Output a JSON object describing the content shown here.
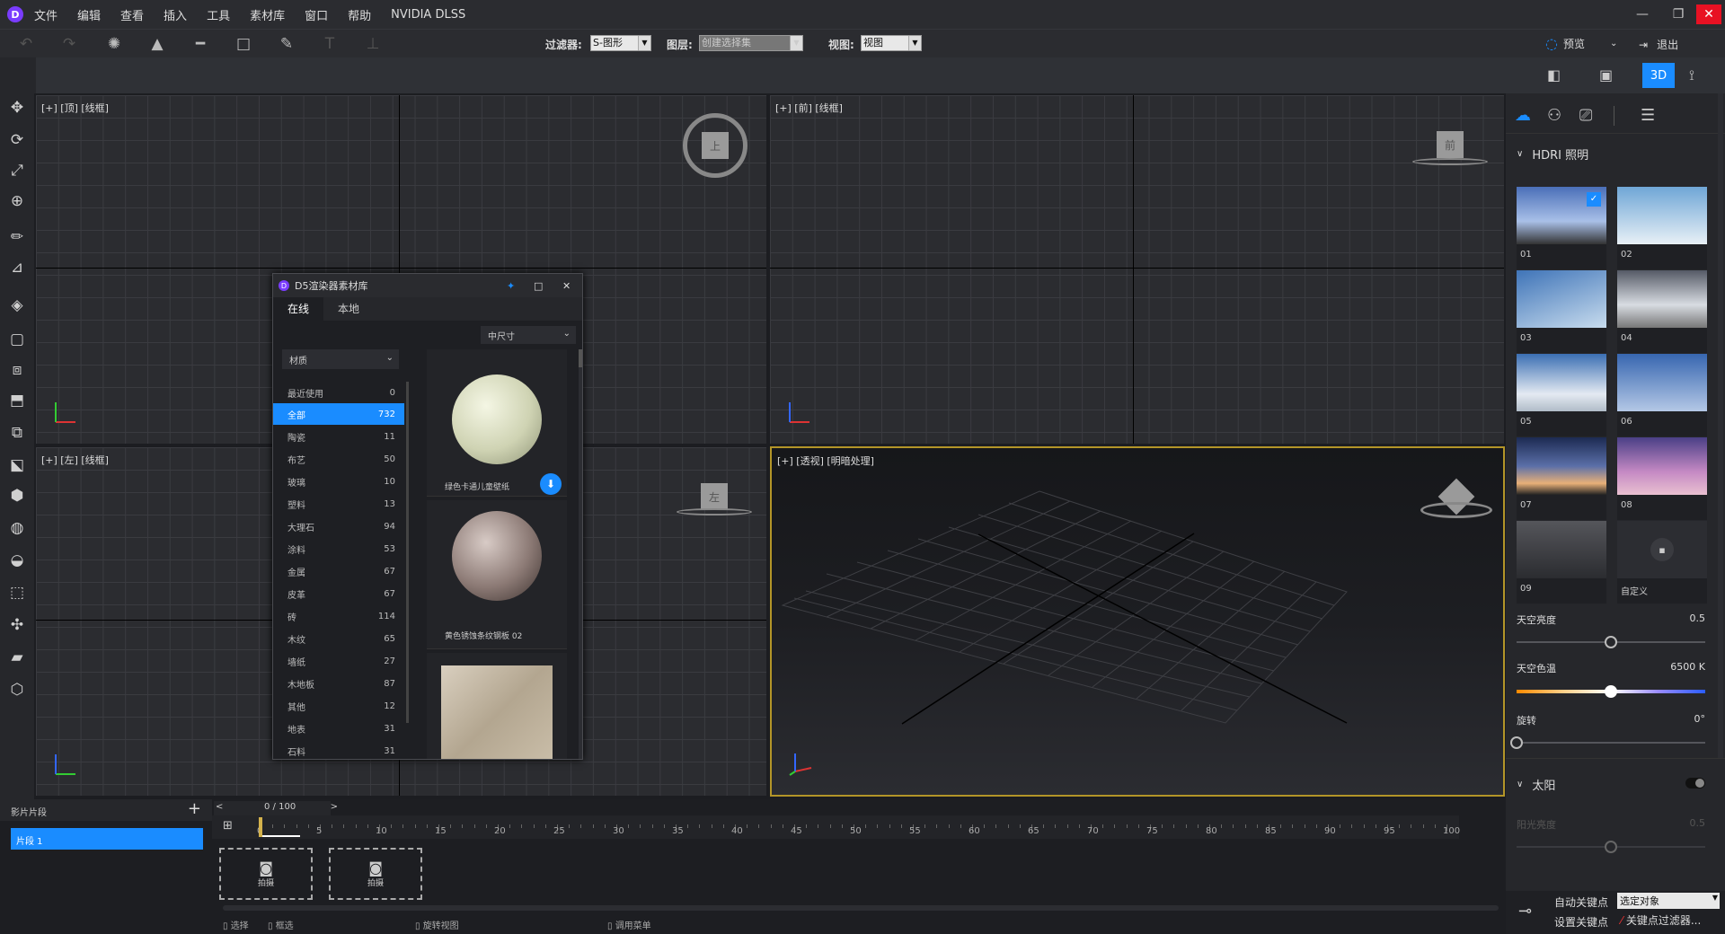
{
  "menu": {
    "logo": "D",
    "items": [
      "文件",
      "编辑",
      "查看",
      "插入",
      "工具",
      "素材库",
      "窗口",
      "帮助",
      "NVIDIA DLSS"
    ]
  },
  "window_controls": {
    "minimize": "—",
    "restore": "❐",
    "close": "✕"
  },
  "toolbar": {
    "filter_label": "过滤器:",
    "filter_value": "S-图形",
    "layer_label": "图层:",
    "layer_value": "创建选择集",
    "view_label": "视图:",
    "view_value": "视图",
    "preview_label": "预览",
    "exit_label": "退出"
  },
  "viewbar": {
    "mode_3d": "3D"
  },
  "viewports": {
    "top": {
      "label": "[+] [顶] [线框]",
      "cube": "上"
    },
    "front": {
      "label": "[+] [前] [线框]",
      "cube": "前"
    },
    "left": {
      "label": "[+] [左] [线框]",
      "cube": "左"
    },
    "persp": {
      "label": "[+] [透视] [明暗处理]"
    }
  },
  "material_dialog": {
    "title": "D5渲染器素材库",
    "tabs": [
      "在线",
      "本地"
    ],
    "size_filter": "中尺寸",
    "category_select": "材质",
    "categories": [
      {
        "name": "最近使用",
        "count": "0"
      },
      {
        "name": "全部",
        "count": "732",
        "active": true
      },
      {
        "name": "陶瓷",
        "count": "11"
      },
      {
        "name": "布艺",
        "count": "50"
      },
      {
        "name": "玻璃",
        "count": "10"
      },
      {
        "name": "塑料",
        "count": "13"
      },
      {
        "name": "大理石",
        "count": "94"
      },
      {
        "name": "涂料",
        "count": "53"
      },
      {
        "name": "金属",
        "count": "67"
      },
      {
        "name": "皮革",
        "count": "67"
      },
      {
        "name": "砖",
        "count": "114"
      },
      {
        "name": "木纹",
        "count": "65"
      },
      {
        "name": "墙纸",
        "count": "27"
      },
      {
        "name": "木地板",
        "count": "87"
      },
      {
        "name": "其他",
        "count": "12"
      },
      {
        "name": "地表",
        "count": "31"
      },
      {
        "name": "石料",
        "count": "31"
      }
    ],
    "items": [
      {
        "name": "绿色卡通儿童壁纸"
      },
      {
        "name": "黄色锈蚀条纹钢板 02"
      }
    ]
  },
  "right_panel": {
    "section_hdri": "HDRI 照明",
    "hdri_thumbs": [
      "01",
      "02",
      "03",
      "04",
      "05",
      "06",
      "07",
      "08",
      "09",
      "自定义"
    ],
    "sky_brightness_label": "天空亮度",
    "sky_brightness_value": "0.5",
    "sky_brightness": 0.5,
    "sky_temp_label": "天空色温",
    "sky_temp_value": "6500 K",
    "sky_temp": 0.5,
    "rotation_label": "旋转",
    "rotation_value": "0°",
    "rotation": 0,
    "section_sun": "太阳",
    "sun_brightness_label": "阳光亮度",
    "sun_brightness_value": "0.5",
    "sun_brightness": 0.5
  },
  "clips": {
    "title": "影片片段",
    "add": "+",
    "items": [
      "片段 1"
    ]
  },
  "timeline": {
    "counter": "0 / 100",
    "ticks": [
      "0",
      "5",
      "10",
      "15",
      "20",
      "25",
      "30",
      "35",
      "40",
      "45",
      "50",
      "55",
      "60",
      "65",
      "70",
      "75",
      "80",
      "85",
      "90",
      "95",
      "100"
    ],
    "shot_label": "拍摄"
  },
  "statusbar": {
    "items": [
      "选择",
      "框选",
      "旋转视图",
      "调用菜单"
    ]
  },
  "keyframes": {
    "auto_key": "自动关键点",
    "auto_key_target": "选定对象",
    "set_key": "设置关键点",
    "key_filter": "关键点过滤器..."
  },
  "colors": {
    "accent": "#1a8cff",
    "persp_border": "#b39528"
  }
}
